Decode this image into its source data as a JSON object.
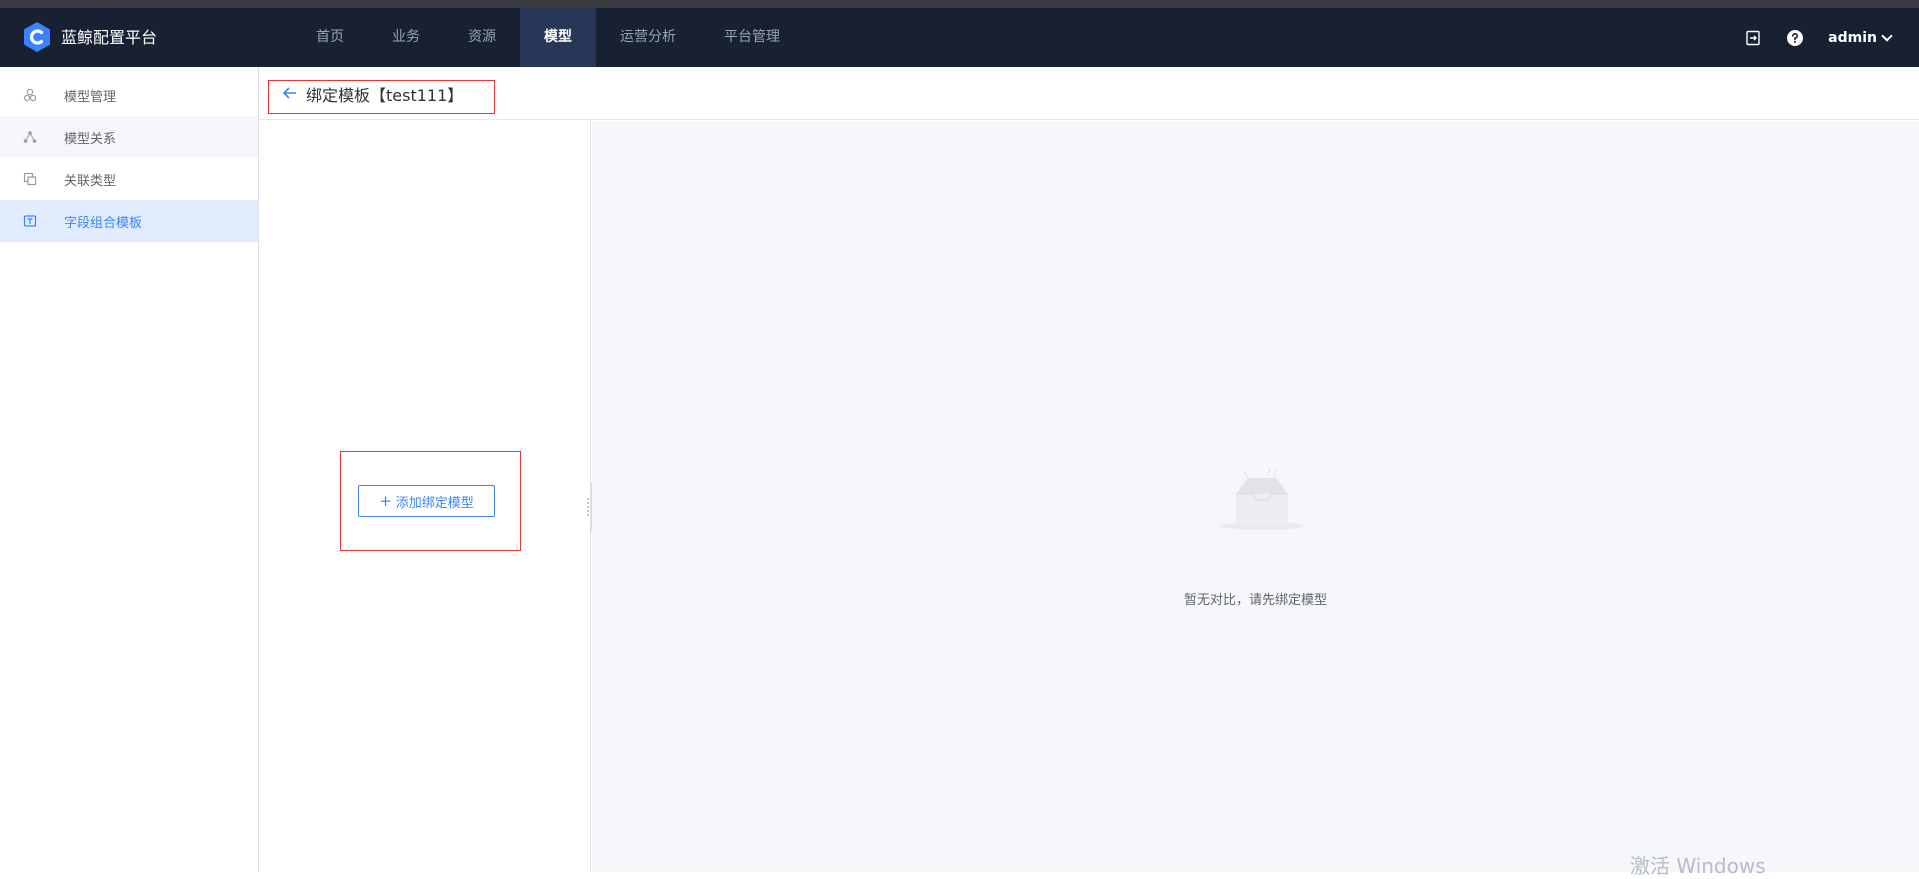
{
  "header": {
    "brand": "蓝鲸配置平台",
    "nav": [
      {
        "label": "首页",
        "active": false
      },
      {
        "label": "业务",
        "active": false
      },
      {
        "label": "资源",
        "active": false
      },
      {
        "label": "模型",
        "active": true
      },
      {
        "label": "运营分析",
        "active": false
      },
      {
        "label": "平台管理",
        "active": false
      }
    ],
    "user": "admin",
    "icons": [
      "logout-icon",
      "help-icon"
    ]
  },
  "sidebar": {
    "items": [
      {
        "label": "模型管理",
        "icon": "model-manage-icon"
      },
      {
        "label": "模型关系",
        "icon": "model-relation-icon"
      },
      {
        "label": "关联类型",
        "icon": "association-type-icon"
      },
      {
        "label": "字段组合模板",
        "icon": "field-template-icon"
      }
    ]
  },
  "page": {
    "title": "绑定模板【test111】"
  },
  "left_panel": {
    "add_button": "添加绑定模型"
  },
  "right_panel": {
    "empty_text": "暂无对比，请先绑定模型"
  },
  "watermark": "激活 Windows",
  "colors": {
    "header_bg": "#182132",
    "accent": "#3a84ff",
    "annotation_red": "#ff2a2a"
  }
}
